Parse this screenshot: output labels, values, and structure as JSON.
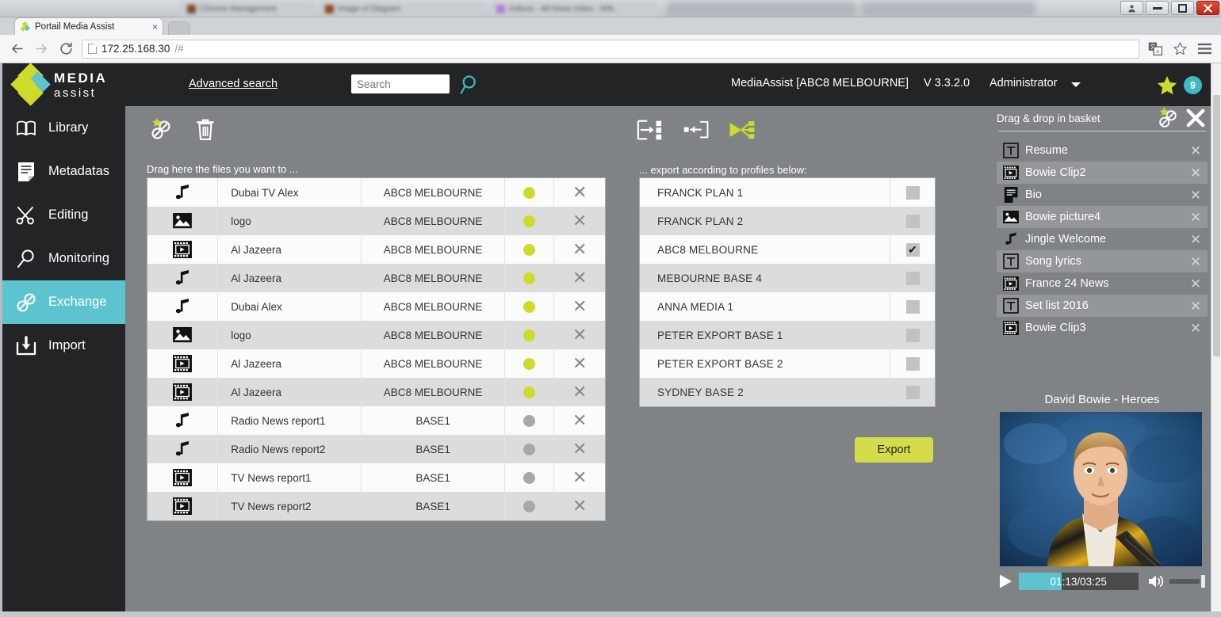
{
  "browser": {
    "tab_title": "Portail Media Assist",
    "tab_close": "×",
    "url": "172.25.168.30",
    "url_hash": "/#",
    "back_icon": "back-arrow-icon",
    "forward_icon": "forward-arrow-icon",
    "reload_icon": "reload-icon",
    "translate_icon": "translate-icon",
    "bookmark_icon": "star-outline-icon",
    "menu_icon": "hamburger-menu-icon",
    "background_tabs": [
      {
        "title": "Chrome Management"
      },
      {
        "title": "Image of Diagram"
      },
      {
        "title": "Indices - All News Index - Wik..."
      }
    ],
    "window_controls": {
      "user": "●",
      "minimize": "—",
      "maximize": "□",
      "close": "✕"
    }
  },
  "header": {
    "logo_line1": "MEDIA",
    "logo_line2": "assist",
    "advanced_search": "Advanced search",
    "search_placeholder": "Search",
    "search_value": "",
    "search_icon": "magnifier-icon",
    "session": "MediaAssist [ABC8 MELBOURNE]",
    "version": "V 3.3.2.0",
    "user": "Administrator",
    "caret_icon": "chevron-down-icon",
    "star_icon": "star-icon",
    "badge_count": "9"
  },
  "sidebar": {
    "items": [
      {
        "label": "Library",
        "icon": "book-icon",
        "active": false
      },
      {
        "label": "Metadatas",
        "icon": "document-icon",
        "active": false
      },
      {
        "label": "Editing",
        "icon": "scissors-icon",
        "active": false
      },
      {
        "label": "Monitoring",
        "icon": "magnifier-icon",
        "active": false
      },
      {
        "label": "Exchange",
        "icon": "link-chain-icon",
        "active": true
      },
      {
        "label": "Import",
        "icon": "download-box-icon",
        "active": false
      }
    ]
  },
  "toolbar": {
    "left": [
      {
        "name": "link-star-icon"
      },
      {
        "name": "trash-icon"
      }
    ],
    "middle": [
      {
        "name": "export-to-list-icon"
      },
      {
        "name": "import-into-box-icon"
      },
      {
        "name": "distribute-fanout-icon"
      }
    ]
  },
  "files_panel": {
    "caption": "Drag here the files you want to ...",
    "rows": [
      {
        "icon": "music-note-icon",
        "name": "Dubai TV Alex",
        "base": "ABC8 MELBOURNE",
        "status": "on",
        "remove": "✕"
      },
      {
        "icon": "image-icon",
        "name": "logo",
        "base": "ABC8 MELBOURNE",
        "status": "on",
        "remove": "✕"
      },
      {
        "icon": "film-icon",
        "name": "Al Jazeera",
        "base": "ABC8 MELBOURNE",
        "status": "on",
        "remove": "✕"
      },
      {
        "icon": "music-note-icon",
        "name": "Al Jazeera",
        "base": "ABC8 MELBOURNE",
        "status": "on",
        "remove": "✕"
      },
      {
        "icon": "music-note-icon",
        "name": "Dubai  Alex",
        "base": "ABC8 MELBOURNE",
        "status": "on",
        "remove": "✕"
      },
      {
        "icon": "image-icon",
        "name": "logo",
        "base": "ABC8 MELBOURNE",
        "status": "on",
        "remove": "✕"
      },
      {
        "icon": "film-icon",
        "name": "Al Jazeera",
        "base": "ABC8 MELBOURNE",
        "status": "on",
        "remove": "✕"
      },
      {
        "icon": "film-icon",
        "name": "Al Jazeera",
        "base": "ABC8 MELBOURNE",
        "status": "on",
        "remove": "✕"
      },
      {
        "icon": "music-note-icon",
        "name": "Radio News report1",
        "base": "BASE1",
        "status": "off",
        "remove": "✕"
      },
      {
        "icon": "music-note-icon",
        "name": "Radio News report2",
        "base": "BASE1",
        "status": "off",
        "remove": "✕"
      },
      {
        "icon": "film-icon",
        "name": "TV News report1",
        "base": "BASE1",
        "status": "off",
        "remove": "✕"
      },
      {
        "icon": "film-icon",
        "name": "TV News report2",
        "base": "BASE1",
        "status": "off",
        "remove": "✕"
      }
    ]
  },
  "profiles_panel": {
    "caption": "... export according to profiles below:",
    "rows": [
      {
        "name": "FRANCK PLAN 1",
        "checked": false
      },
      {
        "name": "FRANCK PLAN 2",
        "checked": false
      },
      {
        "name": "ABC8 MELBOURNE",
        "checked": true
      },
      {
        "name": "MEBOURNE BASE 4",
        "checked": false
      },
      {
        "name": "ANNA MEDIA 1",
        "checked": false
      },
      {
        "name": "PETER EXPORT BASE 1",
        "checked": false
      },
      {
        "name": "PETER EXPORT BASE 2",
        "checked": false
      },
      {
        "name": "SYDNEY BASE 2",
        "checked": false
      }
    ],
    "export_label": "Export"
  },
  "basket": {
    "title": "Drag & drop in basket",
    "link_icon": "link-star-icon",
    "close_icon": "close-icon",
    "items": [
      {
        "icon": "text-box-icon",
        "name": "Resume",
        "remove": "✕"
      },
      {
        "icon": "film-icon",
        "name": "Bowie Clip2",
        "remove": "✕"
      },
      {
        "icon": "document-icon",
        "name": "Bio",
        "remove": "✕"
      },
      {
        "icon": "image-icon",
        "name": "Bowie picture4",
        "remove": "✕"
      },
      {
        "icon": "music-note-icon",
        "name": "Jingle Welcome",
        "remove": "✕"
      },
      {
        "icon": "text-box-icon",
        "name": "Song lyrics",
        "remove": "✕"
      },
      {
        "icon": "film-icon",
        "name": "France 24 News",
        "remove": "✕"
      },
      {
        "icon": "text-box-icon",
        "name": "Set list 2016",
        "remove": "✕"
      },
      {
        "icon": "film-icon",
        "name": "Bowie Clip3",
        "remove": "✕"
      }
    ]
  },
  "player": {
    "title": "David Bowie - Heroes",
    "play_icon": "play-icon",
    "time_label": "01:13/03:25",
    "progress_percent": 36,
    "volume_icon": "speaker-icon",
    "volume_percent": 85
  },
  "colors": {
    "accent_teal": "#5dc4cf",
    "accent_yellow": "#cddc2a",
    "export_button": "#d4dc4a",
    "dark_header": "#222425",
    "workspace_grey": "#7f8386"
  }
}
